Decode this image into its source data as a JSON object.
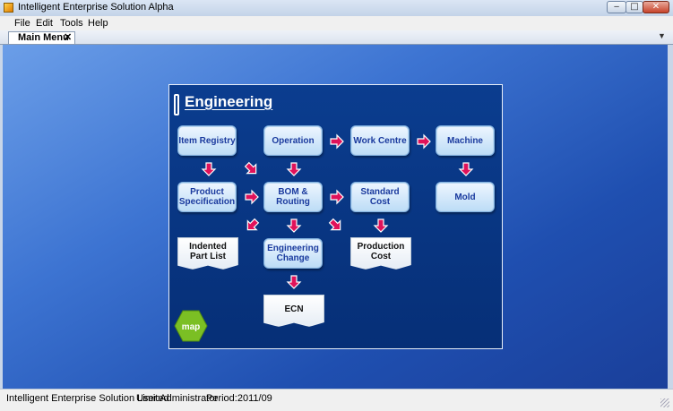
{
  "window": {
    "title": "Intelligent Enterprise Solution Alpha"
  },
  "menu": [
    "File",
    "Edit",
    "Tools",
    "Help"
  ],
  "tab": {
    "label": "Main Menu",
    "close": "✕"
  },
  "panel": {
    "title": "Engineering",
    "nodes": {
      "item_registry": "Item Registry",
      "operation": "Operation",
      "work_centre": "Work Centre",
      "machine": "Machine",
      "product_spec_1": "Product",
      "product_spec_2": "Specification",
      "bom_1": "BOM &",
      "bom_2": "Routing",
      "standard_cost_1": "Standard",
      "standard_cost_2": "Cost",
      "mold": "Mold",
      "engineering_change_1": "Engineering",
      "engineering_change_2": "Change"
    },
    "docs": {
      "indented_1": "Indented",
      "indented_2": "Part List",
      "production_cost_1": "Production",
      "production_cost_2": "Cost",
      "ecn": "ECN"
    },
    "map_label": "map"
  },
  "status": {
    "company": "Intelligent Enterprise Solution Limited",
    "user": "User:Administrator",
    "period": "Period:2011/09"
  },
  "colors": {
    "arrow": "#e0125a",
    "panel": "#0b3d8f",
    "map_hex": "#7bbf24"
  }
}
